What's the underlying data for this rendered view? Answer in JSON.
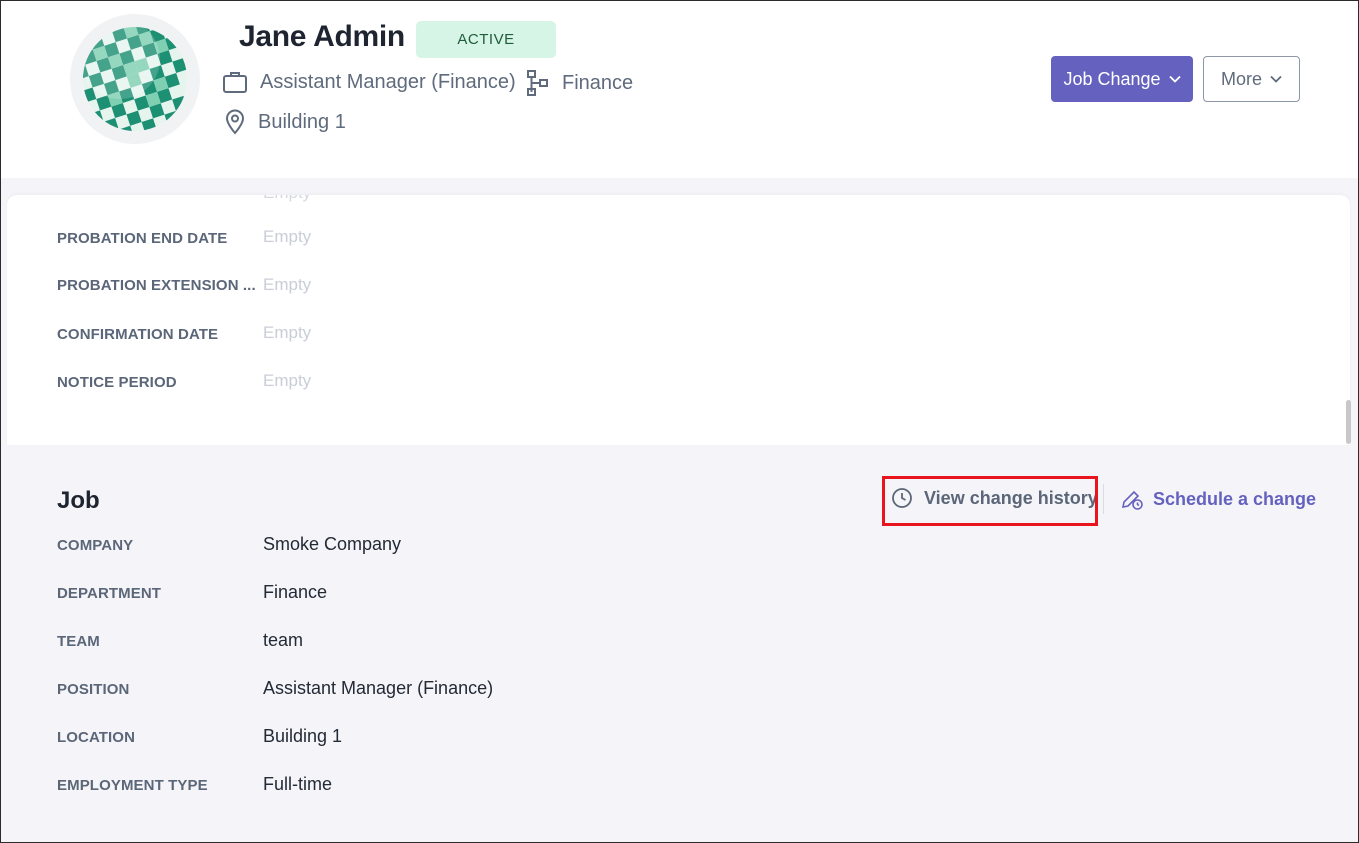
{
  "profile": {
    "name": "Jane Admin",
    "status": "ACTIVE",
    "position": "Assistant Manager (Finance)",
    "department": "Finance",
    "location": "Building 1"
  },
  "header_actions": {
    "job_change_label": "Job Change",
    "more_label": "More"
  },
  "employment_fields": [
    {
      "label": "PROBATION END DATE",
      "value": "Empty"
    },
    {
      "label": "PROBATION EXTENSION ...",
      "value": "Empty"
    },
    {
      "label": "CONFIRMATION DATE",
      "value": "Empty"
    },
    {
      "label": "NOTICE PERIOD",
      "value": "Empty"
    }
  ],
  "job": {
    "title": "Job",
    "view_history_label": "View change history",
    "schedule_label": "Schedule a change",
    "fields": [
      {
        "label": "COMPANY",
        "value": "Smoke Company"
      },
      {
        "label": "DEPARTMENT",
        "value": "Finance"
      },
      {
        "label": "TEAM",
        "value": "team"
      },
      {
        "label": "POSITION",
        "value": "Assistant Manager (Finance)"
      },
      {
        "label": "LOCATION",
        "value": "Building 1"
      },
      {
        "label": "EMPLOYMENT TYPE",
        "value": "Full-time"
      }
    ]
  },
  "colors": {
    "accent": "#6562bf",
    "status_bg": "#d6f5e6",
    "highlight": "#e8141e",
    "page_bg": "#f5f5f9"
  },
  "icons": {
    "position": "briefcase-icon",
    "department": "org-chart-icon",
    "location": "map-pin-icon",
    "history": "clock-icon",
    "schedule": "pen-clock-icon",
    "dropdown": "chevron-down-icon"
  }
}
